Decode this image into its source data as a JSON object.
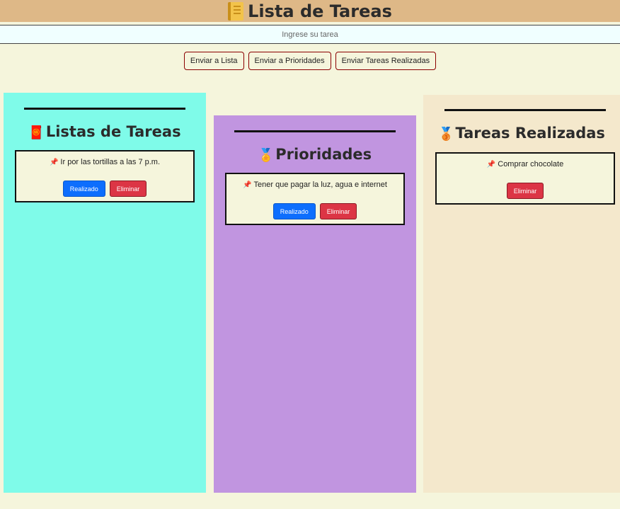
{
  "header": {
    "title": "Lista de Tareas",
    "icon": "notebook-icon"
  },
  "task_input": {
    "value": "",
    "placeholder": "Ingrese su tarea"
  },
  "actions": {
    "send_list": "Enviar a Lista",
    "send_priorities": "Enviar a Prioridades",
    "send_done": "Enviar Tareas Realizadas"
  },
  "columns": {
    "list": {
      "title": "Listas de Tareas",
      "icon": "red-envelope-icon",
      "tasks": [
        {
          "text": "Ir por las tortillas a las 7 p.m.",
          "done_label": "Realizado",
          "delete_label": "Eliminar"
        }
      ]
    },
    "priorities": {
      "title": "Prioridades",
      "icon": "medal-icon",
      "tasks": [
        {
          "text": "Tener que pagar la luz, agua e internet",
          "done_label": "Realizado",
          "delete_label": "Eliminar"
        }
      ]
    },
    "done": {
      "title": "Tareas Realizadas",
      "icon": "bronze-medal-icon",
      "tasks": [
        {
          "text": "Comprar chocolate",
          "delete_label": "Eliminar"
        }
      ]
    }
  },
  "colors": {
    "header_bg": "#deb887",
    "page_bg": "#f5f5dc",
    "list_col": "#7ffbe9",
    "priorities_col": "#c195e0",
    "done_col": "#f4e8cc",
    "done_button": "#0d6efd",
    "delete_button": "#dc3545"
  }
}
